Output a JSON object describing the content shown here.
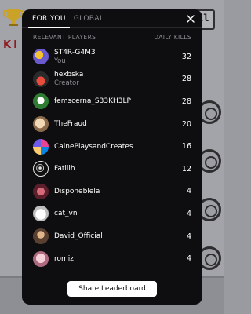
{
  "tabs": [
    {
      "label": "FOR YOU",
      "active": true
    },
    {
      "label": "GLOBAL",
      "active": false
    }
  ],
  "close_icon": "close-icon",
  "header": {
    "players_label": "RELEVANT PLAYERS",
    "kills_label": "DAILY KILLS"
  },
  "players": [
    {
      "name": "ST4R-G4M3",
      "role": "You",
      "kills": "32",
      "avatar_color": "#6a5acd"
    },
    {
      "name": "hexbska",
      "role": "Creator",
      "kills": "28",
      "avatar_color": "#c0392b"
    },
    {
      "name": "femscerna_S33KH3LP",
      "role": "",
      "kills": "28",
      "avatar_color": "#2e7d32"
    },
    {
      "name": "TheFraud",
      "role": "",
      "kills": "20",
      "avatar_color": "#c8a27a"
    },
    {
      "name": "CainePlaysandCreates",
      "role": "",
      "kills": "16",
      "avatar_color": "#b03a8a"
    },
    {
      "name": "Fatiiih",
      "role": "",
      "kills": "12",
      "avatar_color": "#1a1a1a"
    },
    {
      "name": "Disponeblela",
      "role": "",
      "kills": "4",
      "avatar_color": "#8b2e3a"
    },
    {
      "name": "cat_vn",
      "role": "",
      "kills": "4",
      "avatar_color": "#e8e8e8"
    },
    {
      "name": "David_Official",
      "role": "",
      "kills": "4",
      "avatar_color": "#8a6a4a"
    },
    {
      "name": "romiz",
      "role": "",
      "kills": "4",
      "avatar_color": "#d9a0b0"
    }
  ],
  "share_button": "Share Leaderboard"
}
